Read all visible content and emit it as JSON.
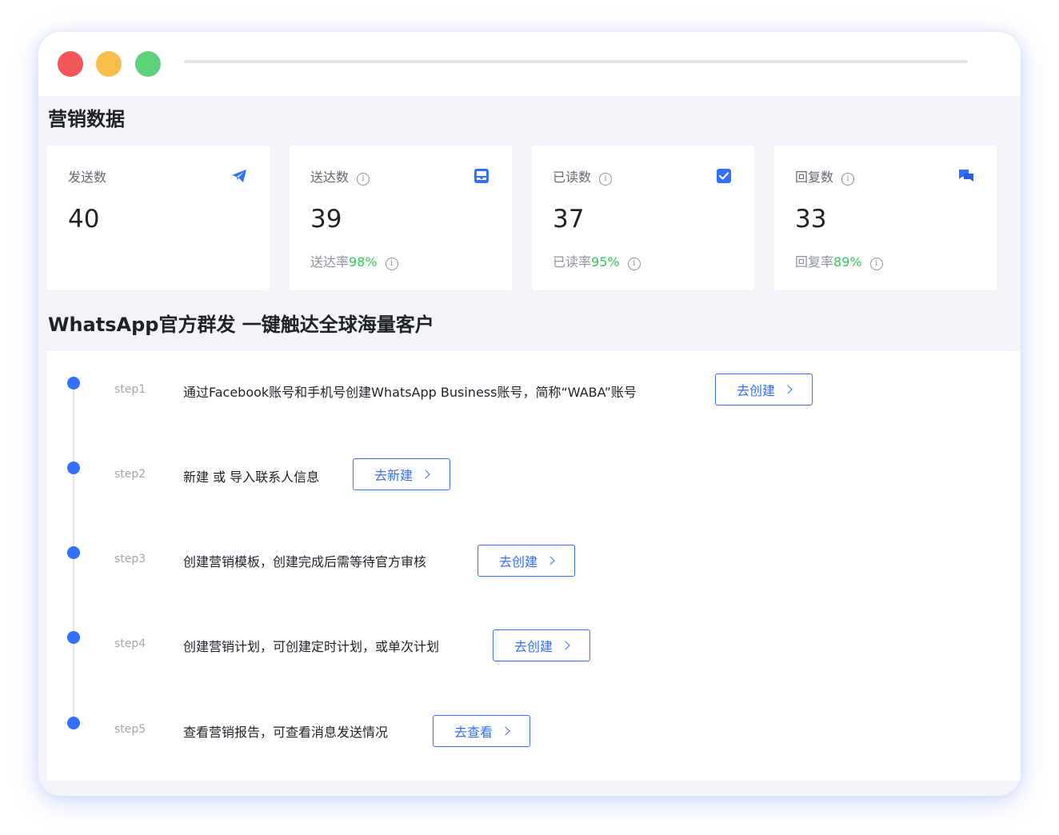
{
  "colors": {
    "accent": "#3370ff",
    "success": "#34c759",
    "close": "#f25656",
    "minimize": "#f7be4b",
    "maximize": "#5ed27a"
  },
  "marketing": {
    "title": "营销数据",
    "cards": [
      {
        "label": "发送数",
        "value": "40",
        "icon": "paper-plane-icon"
      },
      {
        "label": "送达数",
        "value": "39",
        "icon": "inbox-icon",
        "rate_label": "送达率",
        "rate": "98%"
      },
      {
        "label": "已读数",
        "value": "37",
        "icon": "checkbox-icon",
        "rate_label": "已读率",
        "rate": "95%"
      },
      {
        "label": "回复数",
        "value": "33",
        "icon": "chat-bubbles-icon",
        "rate_label": "回复率",
        "rate": "89%"
      }
    ]
  },
  "guide": {
    "title": "WhatsApp官方群发 一键触达全球海量客户",
    "steps": [
      {
        "label": "step1",
        "text": "通过Facebook账号和手机号创建WhatsApp Business账号，简称“WABA”账号",
        "button": "去创建"
      },
      {
        "label": "step2",
        "text": "新建 或 导入联系人信息",
        "button": "去新建"
      },
      {
        "label": "step3",
        "text": "创建营销模板，创建完成后需等待官方审核",
        "button": "去创建"
      },
      {
        "label": "step4",
        "text": "创建营销计划，可创建定时计划，或单次计划",
        "button": "去创建"
      },
      {
        "label": "step5",
        "text": "查看营销报告，可查看消息发送情况",
        "button": "去查看"
      }
    ]
  }
}
